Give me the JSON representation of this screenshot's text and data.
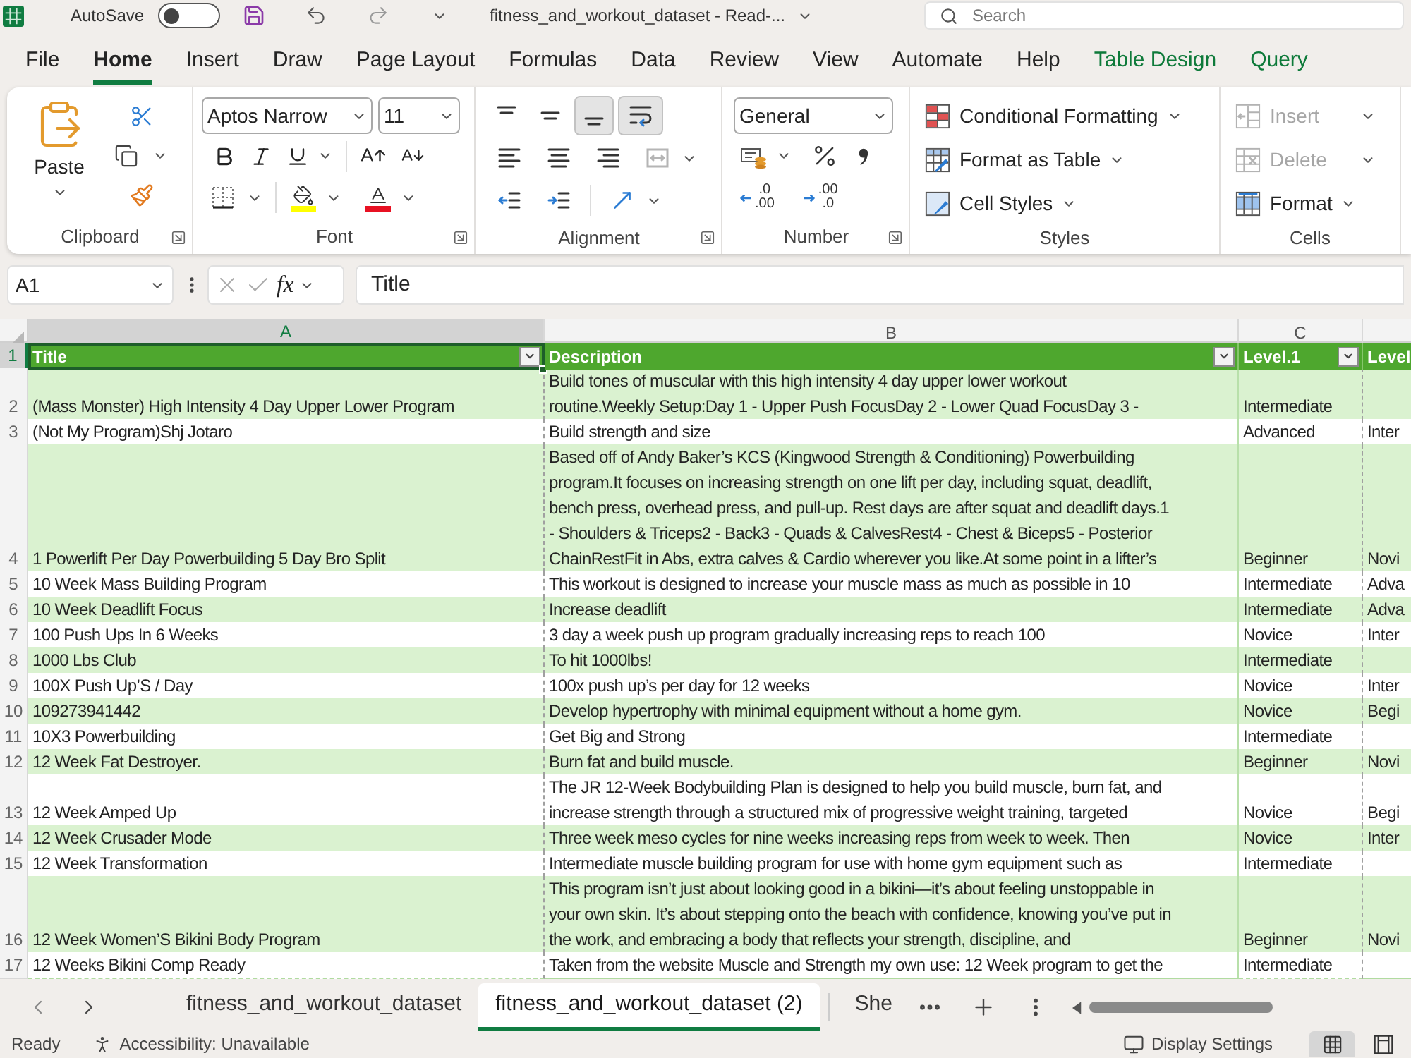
{
  "title_bar": {
    "autosave": {
      "label": "AutoSave",
      "on": false
    },
    "document_title": "fitness_and_workout_dataset - Read-...",
    "search": {
      "placeholder": "Search"
    }
  },
  "menu_tabs": [
    {
      "label": "File",
      "selected": false,
      "kind": "standard"
    },
    {
      "label": "Home",
      "selected": true,
      "kind": "standard"
    },
    {
      "label": "Insert",
      "selected": false,
      "kind": "standard"
    },
    {
      "label": "Draw",
      "selected": false,
      "kind": "standard"
    },
    {
      "label": "Page Layout",
      "selected": false,
      "kind": "standard"
    },
    {
      "label": "Formulas",
      "selected": false,
      "kind": "standard"
    },
    {
      "label": "Data",
      "selected": false,
      "kind": "standard"
    },
    {
      "label": "Review",
      "selected": false,
      "kind": "standard"
    },
    {
      "label": "View",
      "selected": false,
      "kind": "standard"
    },
    {
      "label": "Automate",
      "selected": false,
      "kind": "standard"
    },
    {
      "label": "Help",
      "selected": false,
      "kind": "standard"
    },
    {
      "label": "Table Design",
      "selected": false,
      "kind": "contextual"
    },
    {
      "label": "Query",
      "selected": false,
      "kind": "contextual"
    }
  ],
  "ribbon": {
    "clipboard": {
      "label": "Clipboard",
      "paste_label": "Paste"
    },
    "font": {
      "label": "Font",
      "font_name": "Aptos Narrow",
      "font_size": "11"
    },
    "alignment": {
      "label": "Alignment",
      "rows": [
        [
          {
            "kind": "align_top",
            "selected": false,
            "disabled": false
          },
          {
            "kind": "align_middle",
            "selected": false,
            "disabled": false
          },
          {
            "kind": "align_bottom",
            "selected": true,
            "disabled": false
          },
          {
            "kind": "wrap_text",
            "selected": true,
            "disabled": false
          }
        ],
        [
          {
            "kind": "align_left",
            "selected": false,
            "disabled": false
          },
          {
            "kind": "align_center",
            "selected": false,
            "disabled": false
          },
          {
            "kind": "align_right",
            "selected": false,
            "disabled": false
          },
          {
            "kind": "merge",
            "selected": false,
            "disabled": true
          }
        ],
        [
          {
            "kind": "indent_decrease",
            "selected": false,
            "disabled": false
          },
          {
            "kind": "indent_increase",
            "selected": false,
            "disabled": false
          },
          {
            "kind": "orientation",
            "selected": false,
            "disabled": false
          }
        ]
      ]
    },
    "number": {
      "label": "Number",
      "format": "General",
      "decimal_buttons": [
        {
          "kind": "increase",
          "lines": [
            ".0",
            ".00"
          ]
        },
        {
          "kind": "decrease",
          "lines": [
            ".00",
            ".0"
          ]
        }
      ]
    },
    "styles": {
      "label": "Styles",
      "buttons": [
        {
          "label": "Conditional Formatting",
          "kind": "conditional_formatting"
        },
        {
          "label": "Format as Table",
          "kind": "format_as_table"
        },
        {
          "label": "Cell Styles",
          "kind": "cell_styles"
        }
      ]
    },
    "cells": {
      "label": "Cells",
      "buttons": [
        {
          "label": "Insert",
          "kind": "insert",
          "disabled": true
        },
        {
          "label": "Delete",
          "kind": "delete",
          "disabled": true
        },
        {
          "label": "Format",
          "kind": "format",
          "disabled": false
        }
      ]
    }
  },
  "formula_bar": {
    "name_box": "A1",
    "function_label": "fx",
    "formula": "Title"
  },
  "sheet": {
    "columns": [
      {
        "letter": "A",
        "selected": true
      },
      {
        "letter": "B",
        "selected": false
      },
      {
        "letter": "C",
        "selected": false
      }
    ],
    "header_row": {
      "number": "1",
      "selected": true,
      "cells": [
        {
          "text": "Title",
          "filter": true,
          "active": true
        },
        {
          "text": "Description",
          "filter": true,
          "active": false
        },
        {
          "text": "Level.1",
          "filter": true,
          "active": false
        },
        {
          "text": "Level",
          "active": false
        }
      ]
    },
    "rows": [
      {
        "number": "2",
        "selected": false,
        "title": "(Mass Monster) High Intensity 4 Day Upper Lower Program",
        "description": [
          "Build tones of muscular with this high intensity 4 day upper lower workout",
          "routine.Weekly Setup:Day 1 - Upper Push FocusDay 2 - Lower Quad FocusDay 3 -"
        ],
        "level_1": "Intermediate"
      },
      {
        "number": "3",
        "selected": false,
        "title": "(Not My Program)Shj Jotaro",
        "description": [
          "Build strength and size"
        ],
        "level_1": "Advanced",
        "column_4": "Inter"
      },
      {
        "number": "4",
        "selected": false,
        "title": "1 Powerlift Per Day Powerbuilding 5 Day Bro Split",
        "description": [
          "Based off of Andy Baker’s KCS (Kingwood Strength & Conditioning) Powerbuilding",
          "program.It focuses on increasing strength on one lift per day, including squat, deadlift,",
          "bench press, overhead press, and pull-up. Rest days are after squat and deadlift days.1",
          "- Shoulders & Triceps2 - Back3 - Quads & CalvesRest4 - Chest & Biceps5 - Posterior",
          "ChainRestFit in Abs, extra calves & Cardio wherever you like.At some point in a lifter’s"
        ],
        "level_1": "Beginner",
        "column_4": "Novi"
      },
      {
        "number": "5",
        "selected": false,
        "title": "10 Week Mass Building Program",
        "description": [
          "This workout is designed to increase your muscle mass as much as possible in 10"
        ],
        "level_1": "Intermediate",
        "column_4": "Adva"
      },
      {
        "number": "6",
        "selected": false,
        "title": "10 Week Deadlift Focus",
        "description": [
          "Increase deadlift"
        ],
        "level_1": "Intermediate",
        "column_4": "Adva"
      },
      {
        "number": "7",
        "selected": false,
        "title": "100 Push Ups In 6 Weeks",
        "description": [
          "3 day a week push up program gradually increasing reps to reach 100"
        ],
        "level_1": "Novice",
        "column_4": "Inter"
      },
      {
        "number": "8",
        "selected": false,
        "title": "1000 Lbs Club",
        "description": [
          "To hit 1000lbs!"
        ],
        "level_1": "Intermediate"
      },
      {
        "number": "9",
        "selected": false,
        "title": "100X Push Up’S / Day",
        "description": [
          "100x push up’s per day for 12 weeks"
        ],
        "level_1": "Novice",
        "column_4": "Inter"
      },
      {
        "number": "10",
        "selected": false,
        "title": "109273941442",
        "description": [
          "Develop hypertrophy with minimal equipment without a home gym."
        ],
        "level_1": "Novice",
        "column_4": "Begi"
      },
      {
        "number": "11",
        "selected": false,
        "title": "10X3 Powerbuilding",
        "description": [
          "Get Big and Strong"
        ],
        "level_1": "Intermediate"
      },
      {
        "number": "12",
        "selected": false,
        "title": "12 Week Fat Destroyer.",
        "description": [
          "Burn fat and build muscle."
        ],
        "level_1": "Beginner",
        "column_4": "Novi"
      },
      {
        "number": "13",
        "selected": false,
        "title": "12 Week Amped Up",
        "description": [
          "The JR 12-Week Bodybuilding Plan is designed to help you build muscle, burn fat, and",
          "increase strength through a structured mix of progressive weight training, targeted"
        ],
        "level_1": "Novice",
        "column_4": "Begi"
      },
      {
        "number": "14",
        "selected": false,
        "title": "12 Week Crusader Mode",
        "description": [
          "Three week meso cycles for nine weeks increasing reps from week to week. Then"
        ],
        "level_1": "Novice",
        "column_4": "Inter"
      },
      {
        "number": "15",
        "selected": false,
        "title": "12 Week Transformation",
        "description": [
          "Intermediate muscle building program for use with home gym equipment such as"
        ],
        "level_1": "Intermediate"
      },
      {
        "number": "16",
        "selected": false,
        "title": "12 Week Women’S Bikini Body Program",
        "description": [
          "This program isn’t just about looking good in a bikini—it’s about feeling unstoppable in",
          "your own skin. It’s about stepping onto the beach with confidence, knowing you’ve put in",
          "the work, and embracing a body that reflects your strength, discipline, and"
        ],
        "level_1": "Beginner",
        "column_4": "Novi"
      },
      {
        "number": "17",
        "selected": false,
        "title": "12 Weeks Bikini Comp Ready",
        "description": [
          "Taken from the website Muscle and Strength my own use: 12 Week program to get the"
        ],
        "level_1": "Intermediate"
      }
    ]
  },
  "sheet_tabs": [
    {
      "label": "fitness_and_workout_dataset",
      "selected": false
    },
    {
      "label": "fitness_and_workout_dataset (2)",
      "selected": true
    },
    {
      "label": "She",
      "selected": false
    }
  ],
  "status_bar": {
    "status": "Ready",
    "accessibility": "Accessibility: Unavailable",
    "display_settings": "Display Settings",
    "views": [
      {
        "kind": "normal",
        "selected": true
      },
      {
        "kind": "page_layout",
        "selected": false
      }
    ]
  }
}
